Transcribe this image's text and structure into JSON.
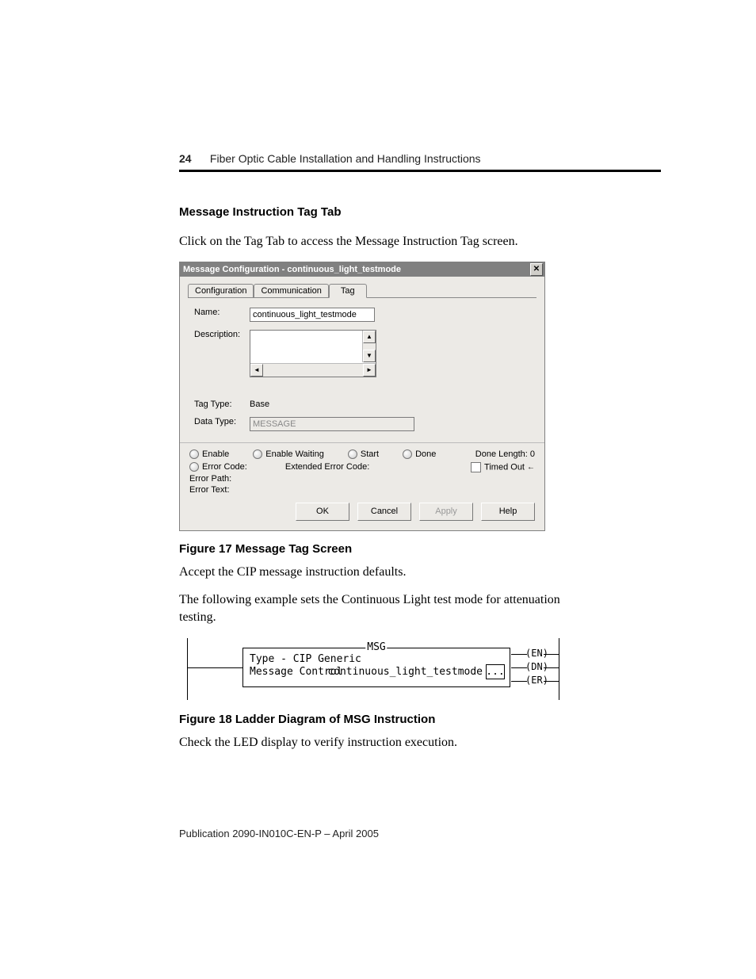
{
  "header": {
    "page_number": "24",
    "doc_title": "Fiber Optic Cable Installation and Handling Instructions"
  },
  "section": {
    "heading": "Message Instruction Tag Tab",
    "intro": "Click on the Tag Tab to access the Message Instruction Tag screen."
  },
  "dialog": {
    "title": "Message Configuration - continuous_light_testmode",
    "tabs": {
      "configuration": "Configuration",
      "communication": "Communication",
      "tag": "Tag"
    },
    "labels": {
      "name": "Name:",
      "description": "Description:",
      "tag_type": "Tag Type:",
      "data_type": "Data Type:"
    },
    "values": {
      "name": "continuous_light_testmode",
      "tag_type": "Base",
      "data_type": "MESSAGE"
    },
    "status": {
      "enable": "Enable",
      "enable_waiting": "Enable Waiting",
      "start": "Start",
      "done": "Done",
      "done_length": "Done Length: 0",
      "error_code": "Error Code:",
      "extended_error_code": "Extended Error Code:",
      "timed_out": "Timed Out",
      "error_path": "Error Path:",
      "error_text": "Error Text:"
    },
    "buttons": {
      "ok": "OK",
      "cancel": "Cancel",
      "apply": "Apply",
      "help": "Help"
    }
  },
  "fig17": {
    "caption": "Figure 17 Message Tag Screen",
    "after1": "Accept the CIP message instruction defaults.",
    "after2": "The following example sets the Continuous Light test mode for attenuation testing."
  },
  "ladder": {
    "box_label": "MSG",
    "type_line": "Type - CIP Generic",
    "ctrl_line": "Message Control",
    "tag": "continuous_light_testmode",
    "dots": "...",
    "en": "EN",
    "dn": "DN",
    "er": "ER"
  },
  "fig18": {
    "caption": "Figure 18 Ladder Diagram of MSG Instruction",
    "after": "Check the LED display to verify instruction execution."
  },
  "footer": "Publication 2090-IN010C-EN-P – April 2005"
}
